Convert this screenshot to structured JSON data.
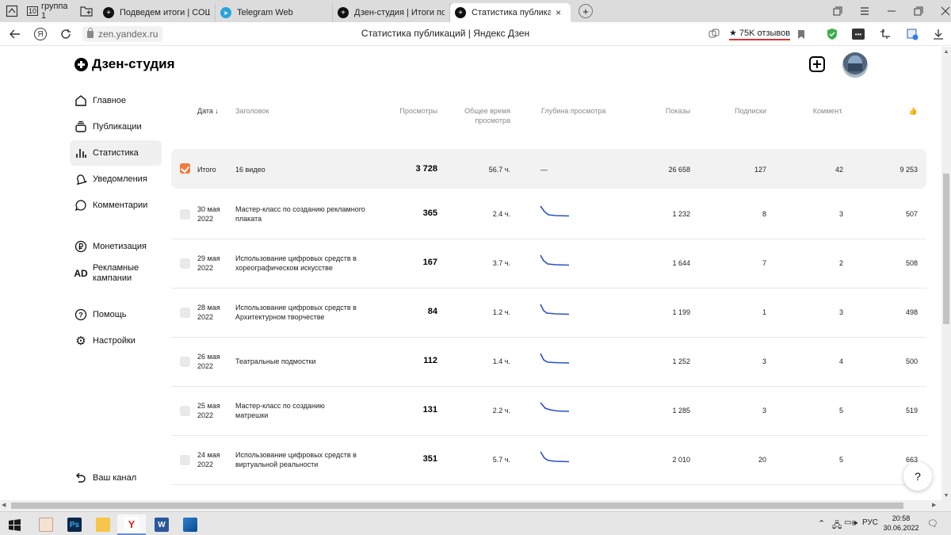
{
  "browser": {
    "tabs": [
      {
        "label": "группа 1"
      },
      {
        "label": "Подведем итоги | СОШ №"
      },
      {
        "label": "Telegram Web"
      },
      {
        "label": "Дзен-студия | Итоги попу"
      },
      {
        "label": "Статистика публикаций"
      }
    ],
    "tab_counter": "10",
    "close_glyph": "×",
    "new_tab_glyph": "+",
    "url": "zen.yandex.ru",
    "page_title": "Статистика публикаций | Яндекс Дзен",
    "reviews": "★ 75K отзывов"
  },
  "app": {
    "logo": "Дзен-студия",
    "sidebar": [
      {
        "label": "Главное",
        "icon": "home-icon"
      },
      {
        "label": "Публикации",
        "icon": "layers-icon"
      },
      {
        "label": "Статистика",
        "icon": "bar-chart-icon"
      },
      {
        "label": "Уведомления",
        "icon": "bell-icon"
      },
      {
        "label": "Комментарии",
        "icon": "comment-icon"
      },
      {
        "label": "Монетизация",
        "icon": "ruble-icon"
      },
      {
        "label": "Рекламные кампании",
        "icon": "ad-icon"
      },
      {
        "label": "Помощь",
        "icon": "help-icon"
      },
      {
        "label": "Настройки",
        "icon": "gear-icon"
      },
      {
        "label": "Ваш канал",
        "icon": "return-icon"
      }
    ],
    "help_fab": "?"
  },
  "table": {
    "headers": {
      "date": "Дата ↓",
      "title": "Заголовок",
      "views": "Просмотры",
      "time": "Общее время просмотра",
      "depth": "Глубина просмотра",
      "impressions": "Показы",
      "subs": "Подписки",
      "comments": "Коммент.",
      "likes": "👍"
    },
    "total": {
      "label": "Итого",
      "title": "16 видео",
      "views": "3 728",
      "time": "56.7 ч.",
      "depth": "—",
      "impressions": "26 658",
      "subs": "127",
      "comments": "42",
      "likes": "9 253"
    },
    "rows": [
      {
        "date": "30 мая 2022",
        "title": "Мастер-класс по созданию рекламного плаката",
        "views": "365",
        "time": "2.4 ч.",
        "impressions": "1 232",
        "subs": "8",
        "comments": "3",
        "likes": "507"
      },
      {
        "date": "29 мая 2022",
        "title": "Использование цифровых средств в хореографическом искусстве",
        "views": "167",
        "time": "3.7 ч.",
        "impressions": "1 644",
        "subs": "7",
        "comments": "2",
        "likes": "508"
      },
      {
        "date": "28 мая 2022",
        "title": "Использование цифровых средств в Архитектурном творчестве",
        "views": "84",
        "time": "1.2 ч.",
        "impressions": "1 199",
        "subs": "1",
        "comments": "3",
        "likes": "498"
      },
      {
        "date": "26 мая 2022",
        "title": "Театральные подмостки",
        "views": "112",
        "time": "1.4 ч.",
        "impressions": "1 252",
        "subs": "3",
        "comments": "4",
        "likes": "500"
      },
      {
        "date": "25 мая 2022",
        "title": "Мастер-класс по созданию матрешки",
        "views": "131",
        "time": "2.2 ч.",
        "impressions": "1 285",
        "subs": "3",
        "comments": "5",
        "likes": "519"
      },
      {
        "date": "24 мая 2022",
        "title": "Использование цифровых средств в виртуальной реальности",
        "views": "351",
        "time": "5.7 ч.",
        "impressions": "2 010",
        "subs": "20",
        "comments": "5",
        "likes": "663"
      }
    ]
  },
  "taskbar": {
    "lang": "РУС",
    "time": "20:58",
    "date": "30.06.2022"
  },
  "colors": {
    "accent_checkbox": "#f07b3f",
    "sparkline": "#2b4fc7"
  }
}
